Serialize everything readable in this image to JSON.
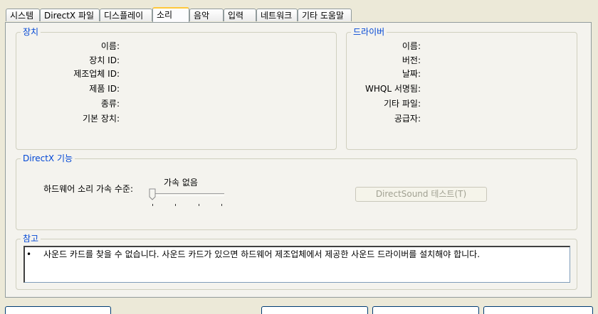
{
  "tabs": [
    {
      "label": "시스템"
    },
    {
      "label": "DirectX 파일"
    },
    {
      "label": "디스플레이"
    },
    {
      "label": "소리"
    },
    {
      "label": "음악"
    },
    {
      "label": "입력"
    },
    {
      "label": "네트워크"
    },
    {
      "label": "기타 도움말"
    }
  ],
  "active_tab": "소리",
  "device": {
    "title": "장치",
    "labels": [
      "이름:",
      "장치 ID:",
      "제조업체 ID:",
      "제품 ID:",
      "종류:",
      "기본 장치:"
    ]
  },
  "driver": {
    "title": "드라이버",
    "labels": [
      "이름:",
      "버전:",
      "날짜:",
      "WHQL 서명됨:",
      "기타 파일:",
      "공급자:"
    ]
  },
  "directx": {
    "title": "DirectX 기능",
    "accel_label": "하드웨어 소리 가속 수준:",
    "accel_value": "가속 없음",
    "accel_level": 0,
    "test_button": "DirectSound 테스트(T)"
  },
  "notes": {
    "title": "참고",
    "bullet": "•",
    "text": "사운드 카드를 찾을 수 없습니다. 사운드 카드가 있으면 하드웨어 제조업체에서 제공한 사운드 드라이버를 설치해야 합니다."
  },
  "colors": {
    "group_title": "#0046d5",
    "active_tab_accent": "#ffc83c",
    "dialog_bg": "#ece9d8"
  }
}
